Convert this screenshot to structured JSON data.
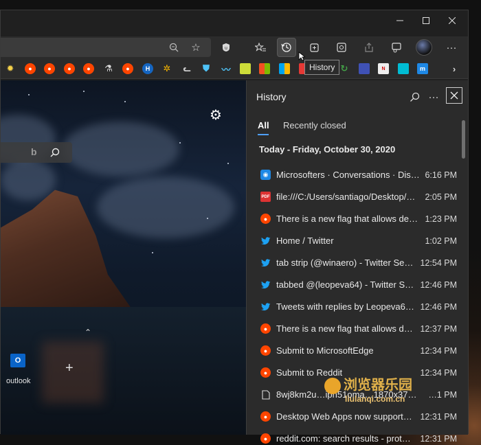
{
  "toolbar": {
    "history_tooltip": "History"
  },
  "favorites": [
    {
      "icon": "lightbulb-icon",
      "label": "💡"
    },
    {
      "icon": "reddit-icon",
      "label": "●"
    },
    {
      "icon": "reddit-icon",
      "label": "●"
    },
    {
      "icon": "reddit-icon",
      "label": "●"
    },
    {
      "icon": "reddit-icon",
      "label": "●"
    },
    {
      "icon": "flask-icon",
      "label": "⚗"
    },
    {
      "icon": "reddit-icon",
      "label": "●"
    },
    {
      "icon": "h-icon",
      "label": "H"
    },
    {
      "icon": "pinwheel-icon",
      "label": "✲"
    },
    {
      "icon": "cat-icon",
      "label": "🐱"
    },
    {
      "icon": "shield-icon",
      "label": "⛊"
    },
    {
      "icon": "wave-icon",
      "label": "〰"
    },
    {
      "icon": "clipboard-icon",
      "label": "▣"
    },
    {
      "icon": "windows-icon",
      "label": "■"
    },
    {
      "icon": "windows-icon",
      "label": "■"
    }
  ],
  "new_tab": {
    "tile_label": "outlook"
  },
  "history": {
    "title": "History",
    "tabs": [
      "All",
      "Recently closed"
    ],
    "date_heading": "Today - Friday, October 30, 2020",
    "items": [
      {
        "icon": "microsofters-icon",
        "title": "Microsofters · Conversations · Dis…",
        "time": "6:16 PM"
      },
      {
        "icon": "pdf-icon",
        "title": "file:///C:/Users/santiago/Desktop/…",
        "time": "2:05 PM"
      },
      {
        "icon": "reddit-icon",
        "title": "There is a new flag that allows des…",
        "time": "1:23 PM"
      },
      {
        "icon": "twitter-icon",
        "title": "Home / Twitter",
        "time": "1:02 PM"
      },
      {
        "icon": "twitter-icon",
        "title": "tab strip (@winaero) - Twitter Se…",
        "time": "12:54 PM"
      },
      {
        "icon": "twitter-icon",
        "title": "tabbed @(leopeva64) - Twitter S…",
        "time": "12:46 PM"
      },
      {
        "icon": "twitter-icon",
        "title": "Tweets with replies by Leopeva6…",
        "time": "12:46 PM"
      },
      {
        "icon": "reddit-icon",
        "title": "There is a new flag that allows d…",
        "time": "12:37 PM"
      },
      {
        "icon": "reddit-icon",
        "title": "Submit to MicrosoftEdge",
        "time": "12:34 PM"
      },
      {
        "icon": "reddit-icon",
        "title": "Submit to Reddit",
        "time": "12:34 PM"
      },
      {
        "icon": "file-icon",
        "title": "8wj8km2u…ipn51oma…1870x373…",
        "time": "…1 PM"
      },
      {
        "icon": "reddit-icon",
        "title": "Desktop Web Apps now support…",
        "time": "12:31 PM"
      },
      {
        "icon": "reddit-icon",
        "title": "reddit.com: search results - prot…",
        "time": "12:31 PM"
      }
    ]
  },
  "watermark": {
    "text": "浏览器乐园",
    "url": "liulanqi.com.cn"
  }
}
